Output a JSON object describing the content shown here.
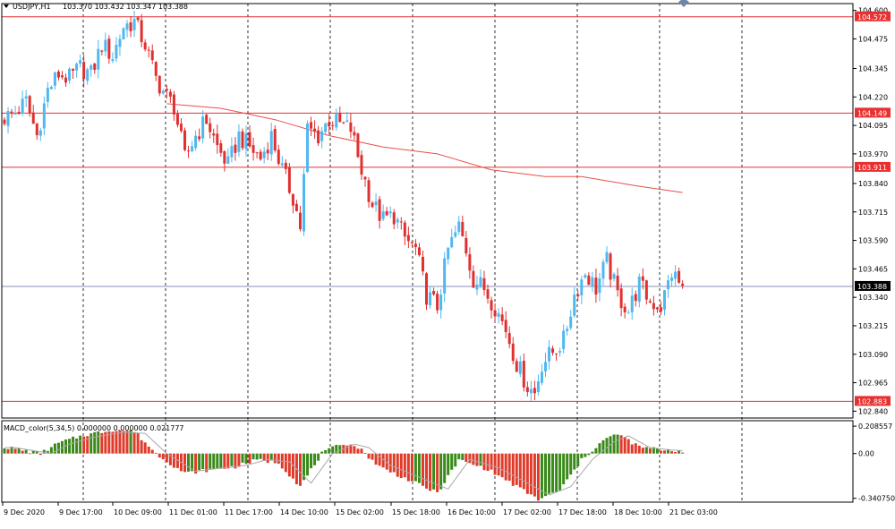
{
  "header": {
    "symbol": "USDJPY,H1",
    "ohlc": "103.370 103.432 103.347 103.388"
  },
  "indicator": {
    "label": "MACD_color(5,34,5) 0.000000 0.000000 0.021777",
    "ticks": [
      "0.208557",
      "0.00",
      "-0.340750"
    ],
    "values": [
      0.208557,
      0,
      -0.34075
    ]
  },
  "colors": {
    "bull": "#4fb8f0",
    "bear": "#e03030",
    "ma": "#e8504a",
    "hline": "#e83030",
    "price_line": "#8890b8",
    "hist_up": "#3a8a1a",
    "hist_down": "#e03a2a",
    "signal": "#a8a8a8",
    "grid": "#000000"
  },
  "chart_data": {
    "type": "candlestick",
    "title": "USDJPY,H1",
    "ylim": [
      102.81,
      104.63
    ],
    "y_ticks": [
      "104.600",
      "104.475",
      "104.345",
      "104.220",
      "104.095",
      "103.970",
      "103.840",
      "103.715",
      "103.590",
      "103.465",
      "103.340",
      "103.215",
      "103.090",
      "102.965",
      "102.840"
    ],
    "x_ticks": [
      "9 Dec 2020",
      "9 Dec 17:00",
      "10 Dec 09:00",
      "11 Dec 01:00",
      "11 Dec 17:00",
      "14 Dec 10:00",
      "15 Dec 02:00",
      "15 Dec 18:00",
      "16 Dec 10:00",
      "17 Dec 02:00",
      "17 Dec 18:00",
      "18 Dec 10:00",
      "21 Dec 03:00"
    ],
    "horizontal_levels": [
      {
        "label": "104.572",
        "value": 104.572
      },
      {
        "label": "104.149",
        "value": 104.149
      },
      {
        "label": "103.911",
        "value": 103.911
      },
      {
        "label": "102.883",
        "value": 102.883
      }
    ],
    "current_price": {
      "label": "103.388",
      "value": 103.388
    },
    "close_path": [
      [
        0,
        104.13
      ],
      [
        3,
        104.15
      ],
      [
        6,
        104.2
      ],
      [
        9,
        104.05
      ],
      [
        12,
        104.25
      ],
      [
        15,
        104.32
      ],
      [
        18,
        104.3
      ],
      [
        21,
        104.35
      ],
      [
        24,
        104.32
      ],
      [
        27,
        104.45
      ],
      [
        30,
        104.4
      ],
      [
        33,
        104.53
      ],
      [
        36,
        104.55
      ],
      [
        39,
        104.45
      ],
      [
        42,
        104.3
      ],
      [
        45,
        104.22
      ],
      [
        47,
        104.18
      ],
      [
        50,
        103.95
      ],
      [
        53,
        104.05
      ],
      [
        56,
        104.12
      ],
      [
        59,
        104.0
      ],
      [
        62,
        103.92
      ],
      [
        65,
        104.05
      ],
      [
        68,
        104.0
      ],
      [
        71,
        103.95
      ],
      [
        74,
        104.05
      ],
      [
        77,
        103.9
      ],
      [
        80,
        103.78
      ],
      [
        82,
        103.65
      ],
      [
        84,
        104.08
      ],
      [
        87,
        104.05
      ],
      [
        90,
        104.12
      ],
      [
        93,
        104.1
      ],
      [
        96,
        104.08
      ],
      [
        99,
        103.9
      ],
      [
        102,
        103.75
      ],
      [
        105,
        103.68
      ],
      [
        108,
        103.7
      ],
      [
        111,
        103.6
      ],
      [
        114,
        103.55
      ],
      [
        117,
        103.35
      ],
      [
        120,
        103.3
      ],
      [
        123,
        103.55
      ],
      [
        126,
        103.65
      ],
      [
        128,
        103.55
      ],
      [
        130,
        103.42
      ],
      [
        133,
        103.38
      ],
      [
        136,
        103.3
      ],
      [
        139,
        103.2
      ],
      [
        142,
        103.05
      ],
      [
        145,
        102.95
      ],
      [
        147,
        102.92
      ],
      [
        149,
        103.05
      ],
      [
        152,
        103.1
      ],
      [
        155,
        103.15
      ],
      [
        158,
        103.35
      ],
      [
        161,
        103.45
      ],
      [
        164,
        103.38
      ],
      [
        167,
        103.5
      ],
      [
        170,
        103.35
      ],
      [
        173,
        103.28
      ],
      [
        176,
        103.4
      ],
      [
        179,
        103.32
      ],
      [
        182,
        103.3
      ],
      [
        185,
        103.45
      ],
      [
        188,
        103.38
      ]
    ],
    "candle_count": 189,
    "moving_average": {
      "points": [
        [
          45,
          104.19
        ],
        [
          60,
          104.17
        ],
        [
          75,
          104.12
        ],
        [
          90,
          104.05
        ],
        [
          105,
          104.0
        ],
        [
          120,
          103.97
        ],
        [
          135,
          103.9
        ],
        [
          150,
          103.87
        ],
        [
          160,
          103.87
        ],
        [
          175,
          103.83
        ],
        [
          188,
          103.8
        ]
      ]
    },
    "macd": {
      "label": "MACD_color(5,34,5) 0.000000 0.000000 0.021777",
      "ylim": [
        -0.37,
        0.25
      ],
      "y_ticks": [
        "0.208557",
        "0.00",
        "-0.340750"
      ],
      "histogram_path": [
        [
          0,
          0.05
        ],
        [
          10,
          0.0
        ],
        [
          15,
          0.08
        ],
        [
          22,
          0.14
        ],
        [
          30,
          0.18
        ],
        [
          36,
          0.17
        ],
        [
          42,
          0.0
        ],
        [
          50,
          -0.15
        ],
        [
          58,
          -0.12
        ],
        [
          64,
          -0.1
        ],
        [
          70,
          -0.05
        ],
        [
          76,
          -0.07
        ],
        [
          82,
          -0.25
        ],
        [
          88,
          0.0
        ],
        [
          94,
          0.08
        ],
        [
          98,
          0.05
        ],
        [
          104,
          -0.1
        ],
        [
          112,
          -0.2
        ],
        [
          120,
          -0.3
        ],
        [
          126,
          -0.05
        ],
        [
          134,
          -0.12
        ],
        [
          142,
          -0.25
        ],
        [
          148,
          -0.35
        ],
        [
          154,
          -0.28
        ],
        [
          160,
          -0.05
        ],
        [
          166,
          0.1
        ],
        [
          170,
          0.15
        ],
        [
          176,
          0.05
        ],
        [
          182,
          0.03
        ],
        [
          188,
          0.02
        ]
      ]
    }
  }
}
